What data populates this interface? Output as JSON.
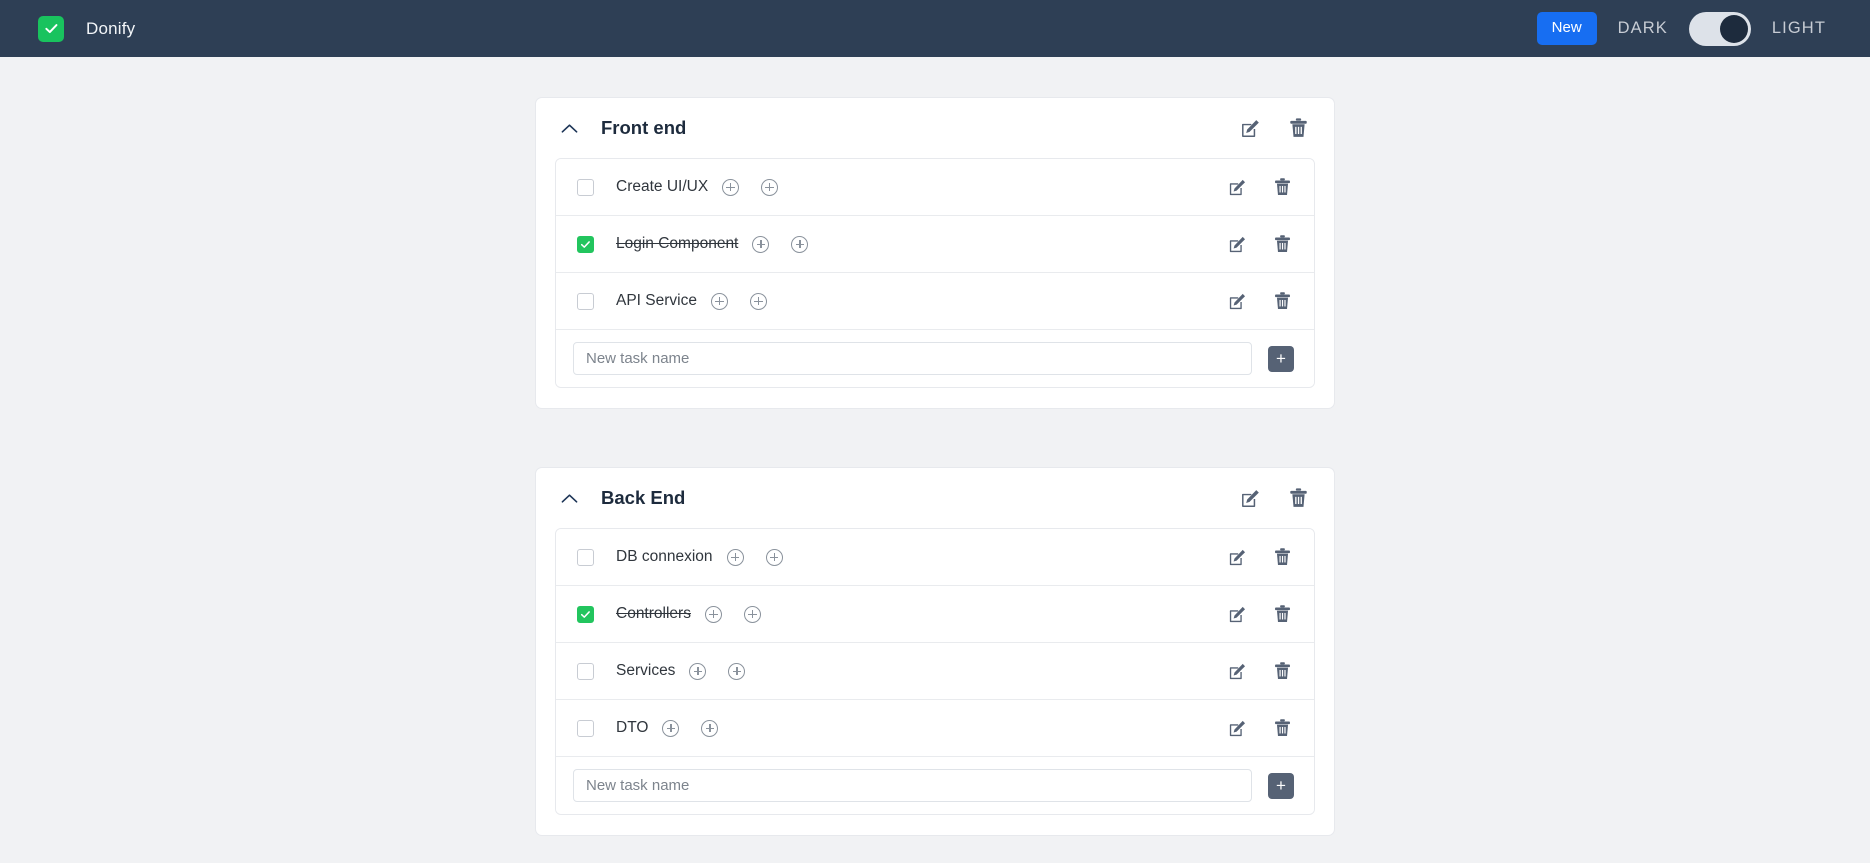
{
  "header": {
    "logo_icon": "check-square-icon",
    "brand": "Donify",
    "new_button": "New",
    "dark_label": "DARK",
    "light_label": "LIGHT",
    "toggle_state": "light",
    "colors": {
      "navbar_bg": "#2e3f55",
      "accent_green": "#19c35e",
      "accent_blue": "#176ef2",
      "knob": "#1d2b3d",
      "track": "#dde2e9"
    }
  },
  "page": {
    "background": "#f1f2f4"
  },
  "common": {
    "edit_icon": "edit-pencil-square-icon",
    "delete_icon": "trash-icon",
    "collapse_icon": "chevron-up-icon",
    "add_icon": "plus-circle-icon",
    "add_button_label": "+",
    "new_task_placeholder": "New task name"
  },
  "cards": [
    {
      "title": "Front end",
      "collapsed": false,
      "tasks": [
        {
          "name": "Create UI/UX",
          "done": false
        },
        {
          "name": "Login Component",
          "done": true
        },
        {
          "name": "API Service",
          "done": false
        }
      ],
      "new_task_value": ""
    },
    {
      "title": "Back End",
      "collapsed": false,
      "tasks": [
        {
          "name": "DB connexion",
          "done": false
        },
        {
          "name": "Controllers",
          "done": true
        },
        {
          "name": "Services",
          "done": false
        },
        {
          "name": "DTO",
          "done": false
        }
      ],
      "new_task_value": ""
    }
  ]
}
